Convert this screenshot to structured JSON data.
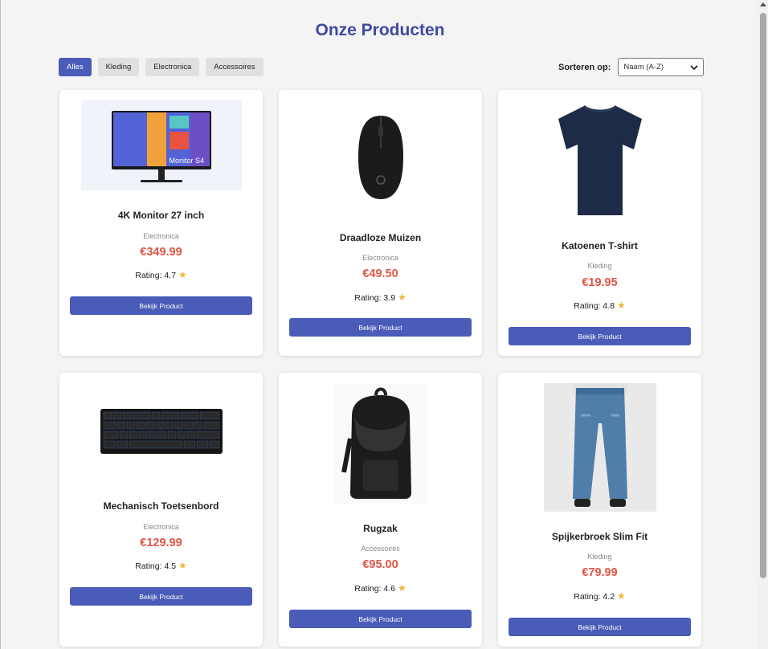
{
  "page": {
    "title": "Onze Producten"
  },
  "filters": [
    {
      "label": "Alles",
      "active": true
    },
    {
      "label": "Kleding",
      "active": false
    },
    {
      "label": "Electronica",
      "active": false
    },
    {
      "label": "Accessoires",
      "active": false
    }
  ],
  "sort": {
    "label": "Sorteren op:",
    "selected": "Naam (A-Z)"
  },
  "products": [
    {
      "name": "4K Monitor 27 inch",
      "category": "Electronica",
      "price": "€349.99",
      "rating_text": "Rating: 4.7",
      "rating": 4.7,
      "button": "Bekijk Product",
      "image_icon": "monitor-image",
      "image_text": "Monitor S4"
    },
    {
      "name": "Draadloze Muizen",
      "category": "Electronica",
      "price": "€49.50",
      "rating_text": "Rating: 3.9",
      "rating": 3.9,
      "button": "Bekijk Product",
      "image_icon": "mouse-image"
    },
    {
      "name": "Katoenen T-shirt",
      "category": "Kleding",
      "price": "€19.95",
      "rating_text": "Rating: 4.8",
      "rating": 4.8,
      "button": "Bekijk Product",
      "image_icon": "tshirt-image"
    },
    {
      "name": "Mechanisch Toetsenbord",
      "category": "Electronica",
      "price": "€129.99",
      "rating_text": "Rating: 4.5",
      "rating": 4.5,
      "button": "Bekijk Product",
      "image_icon": "keyboard-image"
    },
    {
      "name": "Rugzak",
      "category": "Accessoires",
      "price": "€95.00",
      "rating_text": "Rating: 4.6",
      "rating": 4.6,
      "button": "Bekijk Product",
      "image_icon": "backpack-image"
    },
    {
      "name": "Spijkerbroek Slim Fit",
      "category": "Kleding",
      "price": "€79.99",
      "rating_text": "Rating: 4.2",
      "rating": 4.2,
      "button": "Bekijk Product",
      "image_icon": "jeans-image"
    }
  ],
  "colors": {
    "accent": "#4a5bb8",
    "title": "#3f4aa0",
    "price": "#e05545",
    "star": "#f2b636"
  }
}
